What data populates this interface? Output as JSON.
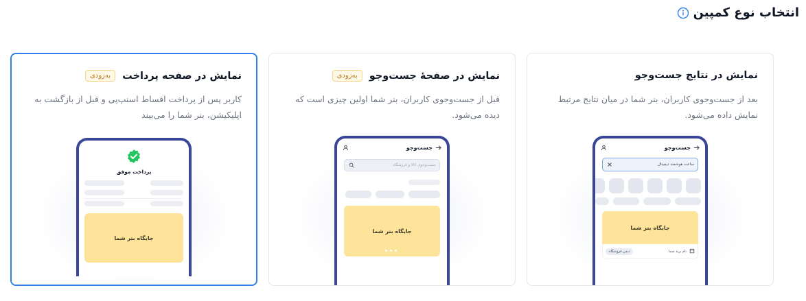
{
  "page": {
    "title": "انتخاب نوع کمپین"
  },
  "cards": [
    {
      "title": "نمایش در نتایج جست‌وجو",
      "description": "بعد از جست‌وجوی کاربران، بنر شما در میان نتایج مرتبط نمایش داده می‌شود.",
      "phone": {
        "header_title": "جست‌وجو",
        "search_value": "ساعت هوشمند دیجیتال",
        "banner_label": "جایگاه بنر شما",
        "shop_name": "نام برند شما",
        "shop_button": "دیدن فروشگاه"
      }
    },
    {
      "title": "نمایش در صفحهٔ جست‌وجو",
      "badge": "به‌زودی",
      "description": "قبل از جست‌وجوی کاربران، بنر شما اولین چیزی است که دیده می‌شود.",
      "phone": {
        "header_title": "جست‌وجو",
        "search_placeholder": "جست‌وجوی کالا و فروشگاه",
        "banner_label": "جایگاه بنر شما"
      }
    },
    {
      "title": "نمایش در صفحه پرداخت",
      "badge": "به‌زودی",
      "description": "کاربر پس از پرداخت اقساط اسنپ‌پی و قبل از بازگشت به اپلیکیشن، بنر شما را می‌بیند",
      "phone": {
        "success_text": "پرداخت موفق",
        "banner_label": "جایگاه بنر شما"
      }
    }
  ],
  "colors": {
    "accent": "#2f80ed",
    "phone_frame": "#3a4597",
    "banner": "#fde49a",
    "badge_text": "#b7791f",
    "success": "#22c55e"
  },
  "icons": {
    "info": "info-icon",
    "back": "arrow-right-icon",
    "profile": "user-icon",
    "search": "search-icon",
    "clear": "close-icon",
    "store": "store-icon",
    "success": "check-badge-icon"
  }
}
